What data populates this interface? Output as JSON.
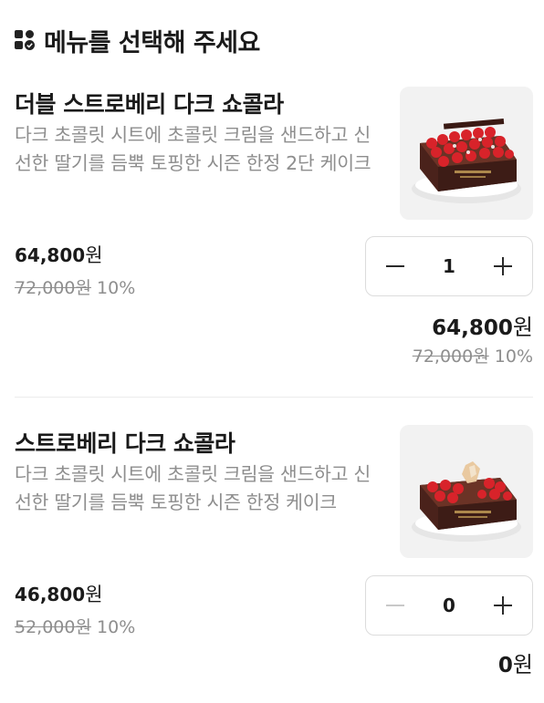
{
  "header": {
    "title": "메뉴를 선택해 주세요",
    "icon": "menu-grid-check-icon"
  },
  "items": [
    {
      "name": "더블 스트로베리 다크 쇼콜라",
      "desc": "다크 초콜릿 시트에 초콜릿 크림을 샌드하고 신선한 딸기를 듬뿍 토핑한 시즌 한정 2단 케이크",
      "price": "64,800",
      "price_unit": "원",
      "orig_price": "72,000원",
      "discount": "10%",
      "qty": "1",
      "total_price": "64,800",
      "total_unit": "원",
      "total_orig": "72,000원",
      "total_discount": "10%",
      "image_icon": "strawberry-chocolate-cake-icon"
    },
    {
      "name": "스트로베리 다크 쇼콜라",
      "desc": "다크 초콜릿 시트에 초콜릿 크림을 샌드하고 신선한 딸기를 듬뿍 토핑한 시즌 한정 케이크",
      "price": "46,800",
      "price_unit": "원",
      "orig_price": "52,000원",
      "discount": "10%",
      "qty": "0",
      "total_price": "0",
      "total_unit": "원",
      "image_icon": "strawberry-chocolate-cake-icon"
    }
  ],
  "colors": {
    "text": "#1a1a1a",
    "muted": "#8e8e8e",
    "border": "#dcdcdc",
    "thumb_bg": "#f2f2f2",
    "cake_chocolate": "#5a2a20",
    "cake_strawberry": "#d8232a"
  }
}
